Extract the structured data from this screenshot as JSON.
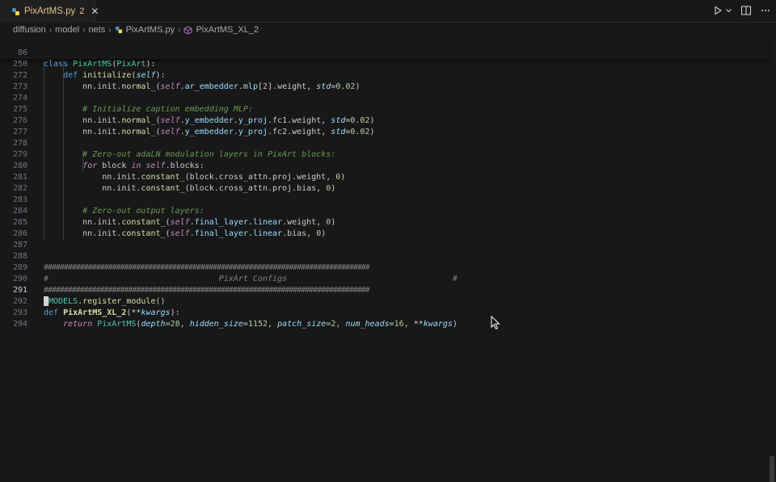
{
  "tab": {
    "filename": "PixArtMS.py",
    "problems": "2",
    "close": "✕"
  },
  "breadcrumb": [
    "diffusion",
    "model",
    "nets",
    "PixArtMS.py",
    "PixArtMS_XL_2"
  ],
  "sticky": [
    {
      "ln": "86",
      "text": "class PixArtMS(PixArt):"
    },
    {
      "ln": "250",
      "text": "    def initialize(self):"
    }
  ],
  "lines": [
    {
      "ln": "272",
      "text": "        nn.init.normal_(self.ar_embedder.mlp[2].weight, std=0.02)"
    },
    {
      "ln": "273",
      "text": ""
    },
    {
      "ln": "274",
      "text": "        # Initialize caption embedding MLP:"
    },
    {
      "ln": "275",
      "text": "        nn.init.normal_(self.y_embedder.y_proj.fc1.weight, std=0.02)"
    },
    {
      "ln": "276",
      "text": "        nn.init.normal_(self.y_embedder.y_proj.fc2.weight, std=0.02)"
    },
    {
      "ln": "277",
      "text": ""
    },
    {
      "ln": "278",
      "text": "        # Zero-out adaLN modulation layers in PixArt blocks:"
    },
    {
      "ln": "279",
      "text": "        for block in self.blocks:"
    },
    {
      "ln": "280",
      "text": "            nn.init.constant_(block.cross_attn.proj.weight, 0)"
    },
    {
      "ln": "281",
      "text": "            nn.init.constant_(block.cross_attn.proj.bias, 0)"
    },
    {
      "ln": "282",
      "text": ""
    },
    {
      "ln": "283",
      "text": "        # Zero-out output layers:"
    },
    {
      "ln": "284",
      "text": "        nn.init.constant_(self.final_layer.linear.weight, 0)"
    },
    {
      "ln": "285",
      "text": "        nn.init.constant_(self.final_layer.linear.bias, 0)"
    },
    {
      "ln": "286",
      "text": ""
    },
    {
      "ln": "287",
      "text": ""
    },
    {
      "ln": "288",
      "text": "#################################################################################"
    },
    {
      "ln": "289",
      "text": "#                                   PixArt Configs                                  #"
    },
    {
      "ln": "290",
      "text": "#################################################################################"
    },
    {
      "ln": "291",
      "text": "@MODELS.register_module()"
    },
    {
      "ln": "292",
      "text": "def PixArtMS_XL_2(**kwargs):"
    },
    {
      "ln": "293",
      "text": "    return PixArtMS(depth=28, hidden_size=1152, patch_size=2, num_heads=16, **kwargs)"
    },
    {
      "ln": "294",
      "text": ""
    }
  ],
  "current_line": "291"
}
